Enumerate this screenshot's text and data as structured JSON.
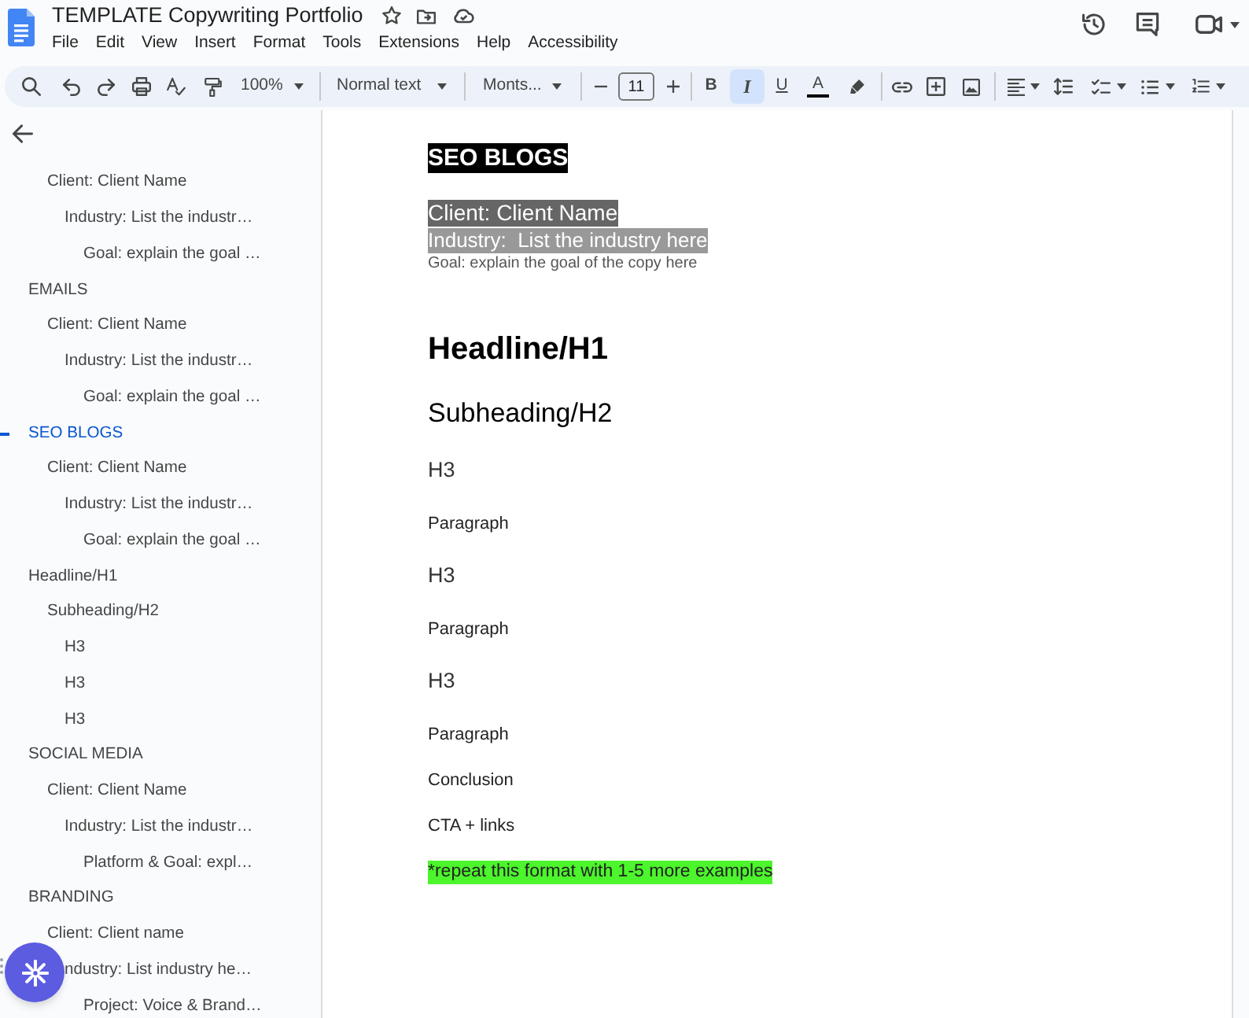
{
  "document": {
    "title": "TEMPLATE Copywriting Portfolio"
  },
  "menu": [
    "File",
    "Edit",
    "View",
    "Insert",
    "Format",
    "Tools",
    "Extensions",
    "Help",
    "Accessibility"
  ],
  "toolbar": {
    "zoom": "100%",
    "paragraph_style": "Normal text",
    "font": "Monts...",
    "font_size": "11",
    "format_buttons": [
      {
        "label": "B",
        "selected": false
      },
      {
        "label": "I",
        "selected": true
      },
      {
        "label": "U",
        "selected": false
      }
    ],
    "text_color_label": "A"
  },
  "outline": [
    {
      "children": [
        {
          "label": "Client: Client Name",
          "selected": false,
          "children": [
            {
              "label": "Industry: List the industr…",
              "selected": false,
              "children": [
                {
                  "label": "Goal: explain the goal …",
                  "selected": false
                }
              ]
            }
          ]
        }
      ]
    },
    {
      "label": "EMAILS",
      "selected": false,
      "children": [
        {
          "label": "Client: Client Name",
          "selected": false,
          "children": [
            {
              "label": "Industry: List the industr…",
              "selected": false,
              "children": [
                {
                  "label": "Goal: explain the goal …",
                  "selected": false
                }
              ]
            }
          ]
        }
      ]
    },
    {
      "label": "SEO BLOGS",
      "selected": true,
      "children": [
        {
          "label": "Client: Client Name",
          "selected": false,
          "children": [
            {
              "label": "Industry: List the industr…",
              "selected": false,
              "children": [
                {
                  "label": "Goal: explain the goal …",
                  "selected": false
                }
              ]
            }
          ]
        }
      ]
    },
    {
      "label": "Headline/H1",
      "selected": false,
      "children": [
        {
          "label": "Subheading/H2",
          "selected": false,
          "children": [
            {
              "label": "H3",
              "selected": false
            },
            {
              "label": "H3",
              "selected": false
            },
            {
              "label": "H3",
              "selected": false
            }
          ]
        }
      ]
    },
    {
      "label": "SOCIAL MEDIA",
      "selected": false,
      "children": [
        {
          "label": "Client: Client Name",
          "selected": false,
          "children": [
            {
              "label": "Industry: List the industr…",
              "selected": false,
              "children": [
                {
                  "label": "Platform & Goal: expl…",
                  "selected": false
                }
              ]
            }
          ]
        }
      ]
    },
    {
      "label": "BRANDING",
      "selected": false,
      "children": [
        {
          "label": "Client: Client name",
          "selected": false,
          "children": [
            {
              "label": "ndustry: List industry he…",
              "selected": false,
              "children": [
                {
                  "label": "Project: Voice & Brand…",
                  "selected": false
                }
              ]
            }
          ]
        }
      ]
    }
  ],
  "page": {
    "lines": [
      {
        "kind": "title",
        "text": "SEO BLOGS"
      },
      {
        "kind": "label_dark",
        "text": "Client: Client Name"
      },
      {
        "kind": "label_light",
        "text": "Industry:  List the industry here"
      },
      {
        "kind": "small",
        "text": "Goal: explain the goal of the copy here"
      },
      {
        "kind": "h1",
        "text": "Headline/H1"
      },
      {
        "kind": "h2",
        "text": "Subheading/H2"
      },
      {
        "kind": "h3",
        "text": "H3"
      },
      {
        "kind": "normal",
        "text": "Paragraph"
      },
      {
        "kind": "h3",
        "text": "H3"
      },
      {
        "kind": "normal",
        "text": "Paragraph"
      },
      {
        "kind": "h3",
        "text": "H3"
      },
      {
        "kind": "normal",
        "text": "Paragraph"
      },
      {
        "kind": "normal",
        "text": "Conclusion"
      },
      {
        "kind": "normal",
        "text": "CTA + links"
      },
      {
        "kind": "note",
        "text": "*repeat this format with 1-5 more examples"
      }
    ]
  }
}
